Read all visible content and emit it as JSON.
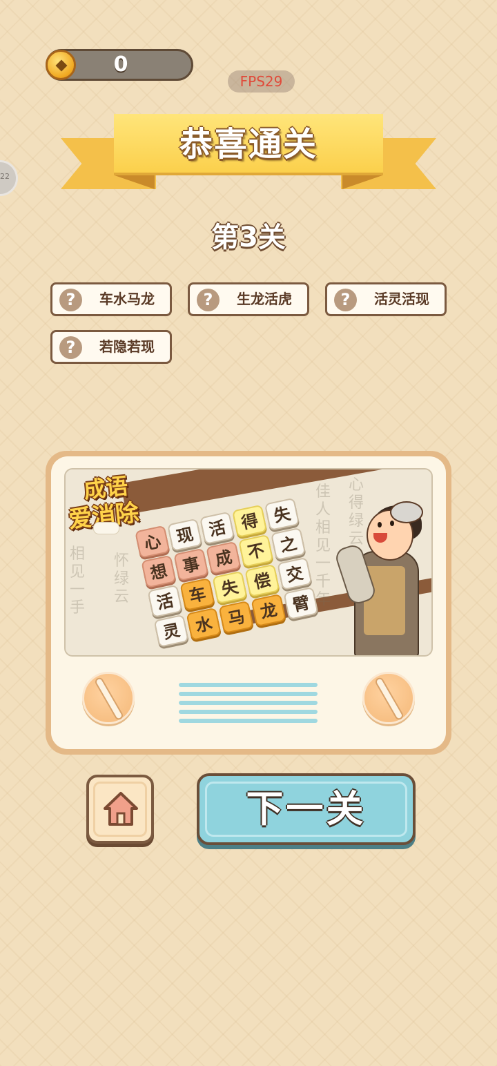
{
  "hud": {
    "coin_count": "0",
    "fps": "FPS29",
    "side_badge": "22"
  },
  "banner": {
    "title": "恭喜通关"
  },
  "level": {
    "title": "第3关"
  },
  "idioms": [
    {
      "hint": "?",
      "text": "车水马龙"
    },
    {
      "hint": "?",
      "text": "生龙活虎"
    },
    {
      "hint": "?",
      "text": "活灵活现"
    },
    {
      "hint": "?",
      "text": "若隐若现"
    }
  ],
  "poster": {
    "logo_line1": "成语",
    "logo_line2": "爱消除",
    "tiles": [
      "心",
      "现",
      "活",
      "得",
      "失",
      "想",
      "事",
      "成",
      "不",
      "之",
      "活",
      "车",
      "失",
      "偿",
      "交",
      "灵",
      "水",
      "马",
      "龙",
      "臂"
    ],
    "calligraphy": [
      "佳人相见一千年",
      "心得绿云",
      "相见一手",
      "怀绿云"
    ]
  },
  "buttons": {
    "home_icon": "home-icon",
    "next_label": "下一关"
  },
  "colors": {
    "background": "#f2dfbd",
    "ribbon": "#fbd04c",
    "next_button": "#8fd3dd",
    "outline": "#7b5a40"
  }
}
